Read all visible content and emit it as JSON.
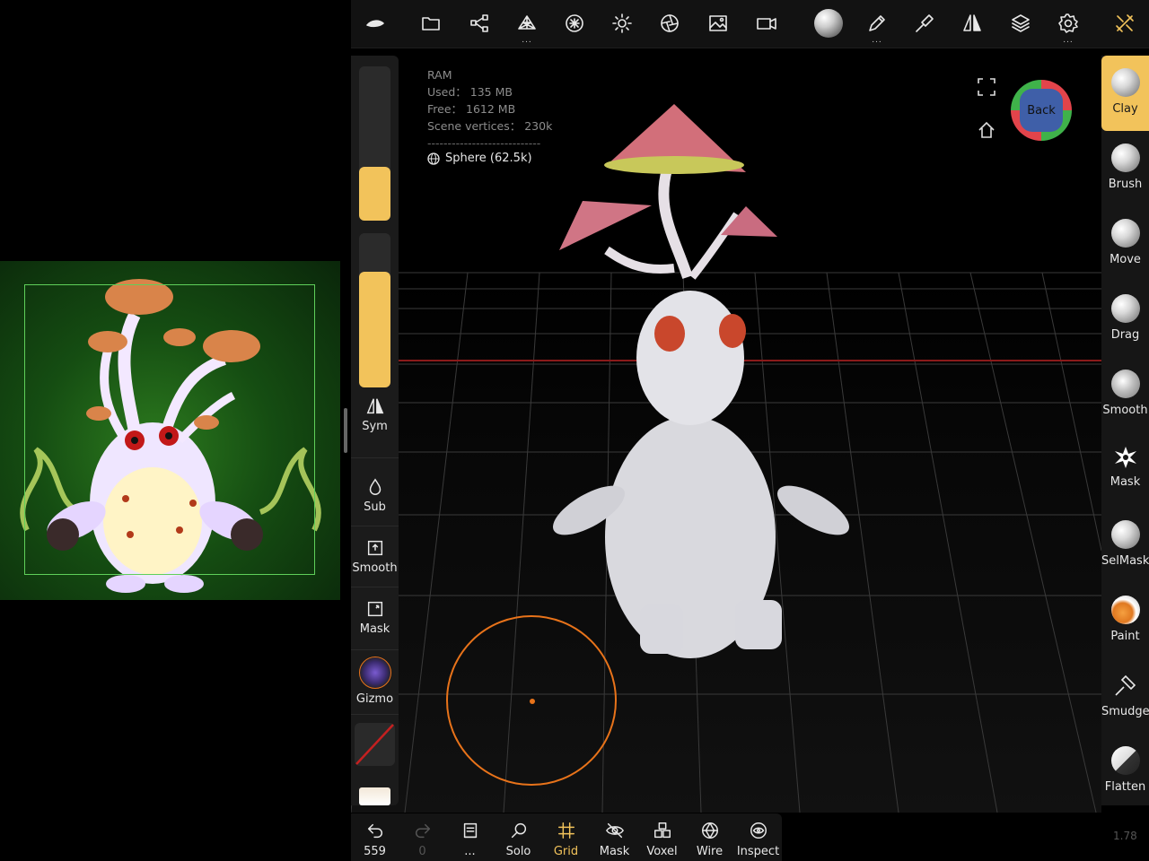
{
  "top_toolbar": {
    "icons": [
      "nomad-logo-icon",
      "folder-icon",
      "scene-tree-icon",
      "topology-icon",
      "material-icon",
      "light-icon",
      "postprocess-icon",
      "background-image-icon",
      "camera-icon",
      "matcap-sphere-icon",
      "stroke-icon",
      "painting-icon",
      "symmetry-icon",
      "layers-icon",
      "settings-icon",
      "tools-icon"
    ]
  },
  "stats": {
    "ram_label": "RAM",
    "used": "Used： 135 MB",
    "free": "Free： 1612 MB",
    "vertices": "Scene vertices： 230k",
    "separator": "----------------------------",
    "object": "Sphere (62.5k)"
  },
  "view_cube": {
    "face_label": "Back"
  },
  "left_panel": {
    "radius_fill": 0.35,
    "intensity_fill": 0.75,
    "sym_label": "Sym",
    "sub_label": "Sub",
    "smooth_label": "Smooth",
    "mask_label": "Mask",
    "gizmo_label": "Gizmo"
  },
  "right_tools": [
    {
      "label": "Clay",
      "active": true
    },
    {
      "label": "Brush",
      "active": false
    },
    {
      "label": "Move",
      "active": false
    },
    {
      "label": "Drag",
      "active": false
    },
    {
      "label": "Smooth",
      "active": false
    },
    {
      "label": "Mask",
      "active": false
    },
    {
      "label": "SelMask",
      "active": false
    },
    {
      "label": "Paint",
      "active": false
    },
    {
      "label": "Smudge",
      "active": false
    },
    {
      "label": "Flatten",
      "active": false
    }
  ],
  "bottom_toolbar": {
    "undo_count": "559",
    "redo_count": "0",
    "solo": "Solo",
    "grid": "Grid",
    "mask": "Mask",
    "voxel": "Voxel",
    "wire": "Wire",
    "inspect": "Inspect",
    "more_dots": "..."
  },
  "version": "1.78",
  "colors": {
    "accent": "#f2c35b",
    "brush_cursor": "#e8731a",
    "panel": "#1b1b1b"
  }
}
